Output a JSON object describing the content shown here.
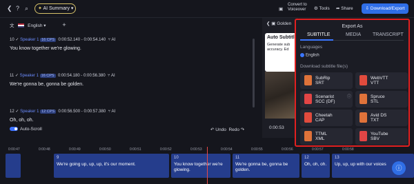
{
  "topbar": {
    "ai_summary_label": "AI Summary",
    "convert_label_1": "Convert to",
    "convert_label_2": "Voiceover",
    "tools_label": "Tools",
    "share_label": "Share",
    "download_label": "Download/Export"
  },
  "editor": {
    "language": "English",
    "segments": [
      {
        "index": "10",
        "speaker": "Speaker 1",
        "cps": "16 CPS",
        "start": "0:00:52.140",
        "end": "0:00:54.140",
        "text": "You know together we're glowing."
      },
      {
        "index": "11",
        "speaker": "Speaker 1",
        "cps": "16 CPS",
        "start": "0:00:54.180",
        "end": "0:00:56.380",
        "text": "We're gonna be, gonna be golden."
      },
      {
        "index": "12",
        "speaker": "Speaker 1",
        "cps": "12 CPS",
        "start": "0:00:56.500",
        "end": "0:00:57.380",
        "text": "Oh, oh, oh."
      }
    ],
    "ai_label": "AI",
    "auto_scroll_label": "Auto-Scroll",
    "undo_label": "Undo",
    "redo_label": "Redo"
  },
  "video": {
    "tab_label": "Golden",
    "card_title": "Auto Subtitl",
    "card_sub_1": "Generate sub",
    "card_sub_2": "accuracy. Ed",
    "time": "0:00:53"
  },
  "export_panel": {
    "title": "Export As",
    "tabs": [
      "SUBTITLE",
      "MEDIA",
      "TRANSCRIPT"
    ],
    "languages_label": "Languages",
    "language_item": "English",
    "download_label": "Download subtitle file(s)",
    "formats": [
      {
        "name": "SubRip",
        "ext": "SRT",
        "color": "#e0733a"
      },
      {
        "name": "WebVTT",
        "ext": "VTT",
        "color": "#e14b3d"
      },
      {
        "name": "Scenarist",
        "ext": "SCC (DF)",
        "color": "#e24545"
      },
      {
        "name": "Spruce",
        "ext": "STL",
        "color": "#e0733a"
      },
      {
        "name": "Cheetah",
        "ext": "CAP",
        "color": "#e14b3d"
      },
      {
        "name": "Avid DS",
        "ext": "TXT",
        "color": "#e0733a"
      },
      {
        "name": "TTML",
        "ext": "XML",
        "color": "#e0733a"
      },
      {
        "name": "YouTube",
        "ext": "SBV",
        "color": "#e24545"
      }
    ]
  },
  "timeline": {
    "ticks": [
      "0:00:47",
      "0:00:48",
      "0:00:49",
      "0:00:50",
      "0:00:51",
      "0:00:52",
      "0:00:53",
      "0:00:54",
      "0:00:55",
      "0:00:56",
      "0:00:57",
      "0:00:58"
    ],
    "blocks": [
      {
        "num": "",
        "text": ""
      },
      {
        "num": "9",
        "text": "We're going up, up, up, it's our moment."
      },
      {
        "num": "10",
        "text": "You know together we're glowing."
      },
      {
        "num": "11",
        "text": "We're gonna be, gonna be golden."
      },
      {
        "num": "12",
        "text": "Oh, oh, oh."
      },
      {
        "num": "13",
        "text": "Up, up, up with our voices"
      }
    ]
  }
}
